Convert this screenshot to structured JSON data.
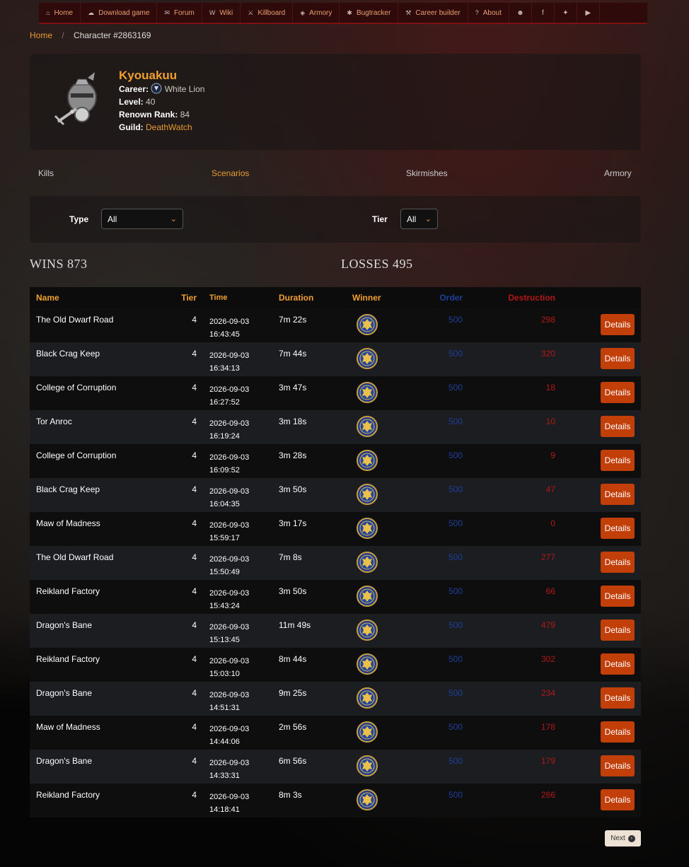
{
  "nav": [
    {
      "label": "Home",
      "icon": "⌂",
      "name": "home"
    },
    {
      "label": "Download game",
      "icon": "☁",
      "name": "download-game"
    },
    {
      "label": "Forum",
      "icon": "✉",
      "name": "forum"
    },
    {
      "label": "Wiki",
      "icon": "W",
      "name": "wiki"
    },
    {
      "label": "Killboard",
      "icon": "⚔",
      "name": "killboard"
    },
    {
      "label": "Armory",
      "icon": "◈",
      "name": "armory"
    },
    {
      "label": "Bugtracker",
      "icon": "✱",
      "name": "bugtracker"
    },
    {
      "label": "Career builder",
      "icon": "⚒",
      "name": "career-builder"
    },
    {
      "label": "About",
      "icon": "?",
      "name": "about"
    }
  ],
  "social": [
    {
      "icon": "☻",
      "name": "discord-icon"
    },
    {
      "icon": "f",
      "name": "facebook-icon"
    },
    {
      "icon": "✦",
      "name": "twitter-icon"
    },
    {
      "icon": "▶",
      "name": "youtube-icon"
    }
  ],
  "breadcrumb": {
    "home": "Home",
    "current": "Character #2863169"
  },
  "character": {
    "name": "Kyouakuu",
    "career_label": "Career:",
    "career": "White Lion",
    "level_label": "Level:",
    "level": "40",
    "renown_label": "Renown Rank:",
    "renown": "84",
    "guild_label": "Guild:",
    "guild": "DeathWatch"
  },
  "tabs": {
    "kills": "Kills",
    "scenarios": "Scenarios",
    "skirmishes": "Skirmishes",
    "armory": "Armory",
    "active": "scenarios"
  },
  "filters": {
    "type_label": "Type",
    "type_value": "All",
    "tier_label": "Tier",
    "tier_value": "All"
  },
  "stats": {
    "wins": "WINS 873",
    "losses": "LOSSES 495"
  },
  "table": {
    "headers": {
      "name": "Name",
      "tier": "Tier",
      "time": "Time",
      "duration": "Duration",
      "winner": "Winner",
      "order": "Order",
      "destruction": "Destruction"
    },
    "button_label": "Details",
    "rows": [
      {
        "name": "The Old Dwarf Road",
        "tier": "4",
        "date": "2026-09-03",
        "clock": "16:43:45",
        "duration": "7m 22s",
        "winner": "order-crest-icon",
        "order": "500",
        "destruction": "298"
      },
      {
        "name": "Black Crag Keep",
        "tier": "4",
        "date": "2026-09-03",
        "clock": "16:34:13",
        "duration": "7m 44s",
        "winner": "order-crest-icon",
        "order": "500",
        "destruction": "320"
      },
      {
        "name": "College of Corruption",
        "tier": "4",
        "date": "2026-09-03",
        "clock": "16:27:52",
        "duration": "3m 47s",
        "winner": "order-crest-icon",
        "order": "500",
        "destruction": "18"
      },
      {
        "name": "Tor Anroc",
        "tier": "4",
        "date": "2026-09-03",
        "clock": "16:19:24",
        "duration": "3m 18s",
        "winner": "order-crest-icon",
        "order": "500",
        "destruction": "10"
      },
      {
        "name": "College of Corruption",
        "tier": "4",
        "date": "2026-09-03",
        "clock": "16:09:52",
        "duration": "3m 28s",
        "winner": "order-crest-icon",
        "order": "500",
        "destruction": "9"
      },
      {
        "name": "Black Crag Keep",
        "tier": "4",
        "date": "2026-09-03",
        "clock": "16:04:35",
        "duration": "3m 50s",
        "winner": "order-crest-icon",
        "order": "500",
        "destruction": "47"
      },
      {
        "name": "Maw of Madness",
        "tier": "4",
        "date": "2026-09-03",
        "clock": "15:59:17",
        "duration": "3m 17s",
        "winner": "order-crest-icon",
        "order": "500",
        "destruction": "0"
      },
      {
        "name": "The Old Dwarf Road",
        "tier": "4",
        "date": "2026-09-03",
        "clock": "15:50:49",
        "duration": "7m 8s",
        "winner": "order-crest-icon",
        "order": "500",
        "destruction": "277"
      },
      {
        "name": "Reikland Factory",
        "tier": "4",
        "date": "2026-09-03",
        "clock": "15:43:24",
        "duration": "3m 50s",
        "winner": "order-crest-icon",
        "order": "500",
        "destruction": "66"
      },
      {
        "name": "Dragon's Bane",
        "tier": "4",
        "date": "2026-09-03",
        "clock": "15:13:45",
        "duration": "11m 49s",
        "winner": "order-crest-icon",
        "order": "500",
        "destruction": "479"
      },
      {
        "name": "Reikland Factory",
        "tier": "4",
        "date": "2026-09-03",
        "clock": "15:03:10",
        "duration": "8m 44s",
        "winner": "order-crest-icon",
        "order": "500",
        "destruction": "302"
      },
      {
        "name": "Dragon's Bane",
        "tier": "4",
        "date": "2026-09-03",
        "clock": "14:51:31",
        "duration": "9m 25s",
        "winner": "order-crest-icon",
        "order": "500",
        "destruction": "234"
      },
      {
        "name": "Maw of Madness",
        "tier": "4",
        "date": "2026-09-03",
        "clock": "14:44:06",
        "duration": "2m 56s",
        "winner": "order-crest-icon",
        "order": "500",
        "destruction": "178"
      },
      {
        "name": "Dragon's Bane",
        "tier": "4",
        "date": "2026-09-03",
        "clock": "14:33:31",
        "duration": "6m 56s",
        "winner": "order-crest-icon",
        "order": "500",
        "destruction": "179"
      },
      {
        "name": "Reikland Factory",
        "tier": "4",
        "date": "2026-09-03",
        "clock": "14:18:41",
        "duration": "8m 3s",
        "winner": "order-crest-icon",
        "order": "500",
        "destruction": "266"
      }
    ]
  },
  "pagination": {
    "next": "Next"
  },
  "colors": {
    "accent": "#e89a30",
    "order": "#1f3f9a",
    "destruction": "#b01818",
    "button": "#c23f0a"
  }
}
